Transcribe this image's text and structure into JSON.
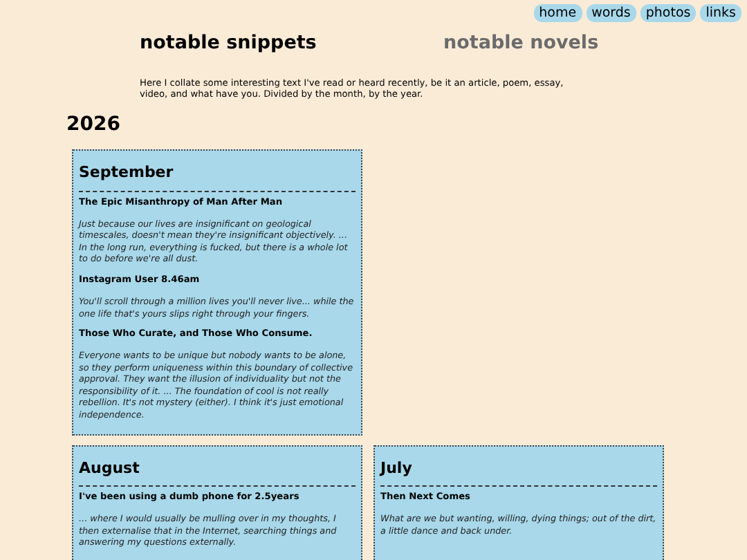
{
  "nav": [
    {
      "label": "home"
    },
    {
      "label": "words"
    },
    {
      "label": "photos"
    },
    {
      "label": "links"
    }
  ],
  "tabs": [
    {
      "label": "notable snippets",
      "selected": true
    },
    {
      "label": "notable novels",
      "selected": false
    }
  ],
  "intro": "Here I collate some interesting text I've read or heard recently, be it an article, poem, essay, video, and what have you. Divided by the month, by the year.",
  "year": "2026",
  "months": [
    {
      "name": "September",
      "entries": [
        {
          "title": "The Epic Misanthropy of Man After Man",
          "quote": "Just because our lives are insignificant on geological timescales, doesn't mean they're insignificant objectively. ... In the long run, everything is fucked, but there is a whole lot to do before we're all dust."
        },
        {
          "title": "Instagram User 8.46am",
          "quote": "You'll scroll through a million lives you'll never live... while the one life that's yours slips right through your fingers."
        },
        {
          "title": "Those Who Curate, and Those Who Consume.",
          "quote": "Everyone wants to be unique but nobody wants to be alone, so they perform uniqueness within this boundary of collective approval. They want the illusion of individuality but not the responsibility of it. ... The foundation of cool is not really rebellion. It's not mystery (either). I think it's just emotional independence."
        }
      ]
    },
    {
      "name": "August",
      "entries": [
        {
          "title": "I've been using a dumb phone for 2.5years",
          "quote": "... where I would usually be mulling over in my thoughts, I then externalise that in the Internet, searching things and answering my questions externally."
        }
      ]
    },
    {
      "name": "July",
      "entries": [
        {
          "title": "Then Next Comes",
          "quote": "What are we but wanting, willing, dying things; out of the dirt, a little dance and back under."
        }
      ]
    }
  ]
}
